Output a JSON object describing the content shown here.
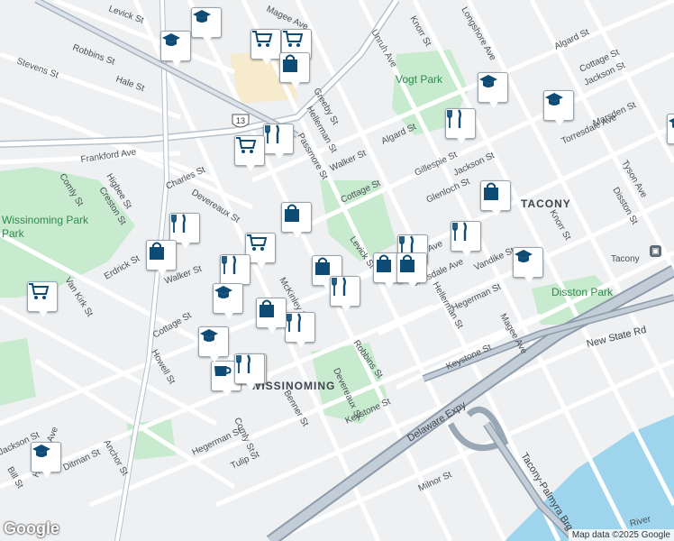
{
  "map": {
    "neighborhoods": [
      "TACONY",
      "WISSINOMING"
    ],
    "parks": [
      "Vogt Park",
      "Disston Park",
      "Wissinoming Park"
    ],
    "route_shield": "13",
    "highways": [
      "Delaware Expy",
      "New State Rd",
      "Tacony-Palmyra Brg"
    ],
    "transit_station": "Tacony",
    "river_label": "River",
    "streets": [
      "Levick St",
      "Robbins St",
      "Magee Ave",
      "Stevens St",
      "Hale St",
      "Frankford Ave",
      "Comly St",
      "Higbee St",
      "Creston St",
      "Charles St",
      "Devereaux St",
      "Wissinoming St",
      "Erdrick St",
      "Van Kirk St",
      "Walker St",
      "Cottage St",
      "Howell St",
      "McKinley St",
      "Greeby St",
      "Hellerman St",
      "Passmore St",
      "Unruh Ave",
      "Knorr St",
      "Longshore Ave",
      "Algard St",
      "Walker St",
      "Gillespie St",
      "Jackson St",
      "Glenloch St",
      "Torresdale Ave",
      "Marsden St",
      "Tyson Ave",
      "Disston St",
      "Vandike St",
      "Hegerman St",
      "Keystone St",
      "Benner St",
      "Tulip St",
      "Milnor St",
      "Anchor St",
      "Ditman St",
      "Bill St",
      "Jackson St",
      "Harbison Ave",
      "Cottage St"
    ],
    "pois": [
      {
        "type": "school",
        "icon": "school-icon"
      },
      {
        "type": "school",
        "icon": "school-icon"
      },
      {
        "type": "shopping",
        "icon": "shopping-cart-icon"
      },
      {
        "type": "shopping",
        "icon": "shopping-cart-icon"
      },
      {
        "type": "shopping",
        "icon": "shopping-bag-icon"
      },
      {
        "type": "restaurant",
        "icon": "restaurant-icon"
      },
      {
        "type": "shopping",
        "icon": "shopping-cart-icon"
      },
      {
        "type": "shopping",
        "icon": "shopping-bag-icon"
      },
      {
        "type": "restaurant",
        "icon": "restaurant-icon"
      },
      {
        "type": "shopping",
        "icon": "shopping-bag-icon"
      },
      {
        "type": "shopping",
        "icon": "shopping-cart-icon"
      },
      {
        "type": "restaurant",
        "icon": "restaurant-icon"
      },
      {
        "type": "school",
        "icon": "school-icon"
      },
      {
        "type": "shopping",
        "icon": "shopping-bag-icon"
      },
      {
        "type": "restaurant",
        "icon": "restaurant-icon"
      },
      {
        "type": "restaurant",
        "icon": "restaurant-icon"
      },
      {
        "type": "cafe",
        "icon": "cafe-icon"
      },
      {
        "type": "school",
        "icon": "school-icon"
      },
      {
        "type": "shopping",
        "icon": "shopping-bag-icon"
      },
      {
        "type": "shopping",
        "icon": "shopping-bag-icon"
      },
      {
        "type": "restaurant",
        "icon": "restaurant-icon"
      },
      {
        "type": "school",
        "icon": "school-icon"
      },
      {
        "type": "shopping",
        "icon": "shopping-bag-icon"
      },
      {
        "type": "restaurant",
        "icon": "restaurant-icon"
      },
      {
        "type": "shopping",
        "icon": "shopping-bag-icon"
      },
      {
        "type": "restaurant",
        "icon": "restaurant-icon"
      },
      {
        "type": "school",
        "icon": "school-icon"
      },
      {
        "type": "school",
        "icon": "school-icon"
      },
      {
        "type": "school",
        "icon": "school-icon"
      },
      {
        "type": "shopping",
        "icon": "shopping-cart-icon"
      },
      {
        "type": "restaurant",
        "icon": "restaurant-icon"
      },
      {
        "type": "school",
        "icon": "school-icon"
      },
      {
        "type": "restaurant",
        "icon": "restaurant-icon"
      }
    ]
  },
  "attribution": "Map data ©2025 Google",
  "logo": "Google"
}
